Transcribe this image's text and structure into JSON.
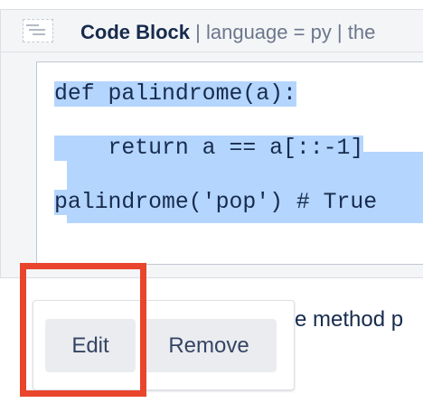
{
  "macro": {
    "name": "Code Block",
    "params": " | language = py | the",
    "icon": "code-macro-icon"
  },
  "code": {
    "lines": [
      "def palindrome(a):",
      "    return a == a[::-1]",
      "palindrome('pop') # True"
    ]
  },
  "body_text": "e method p",
  "toolbar": {
    "edit_label": "Edit",
    "remove_label": "Remove"
  },
  "colors": {
    "selection": "#b4d5fe",
    "highlight": "#e8452c"
  }
}
